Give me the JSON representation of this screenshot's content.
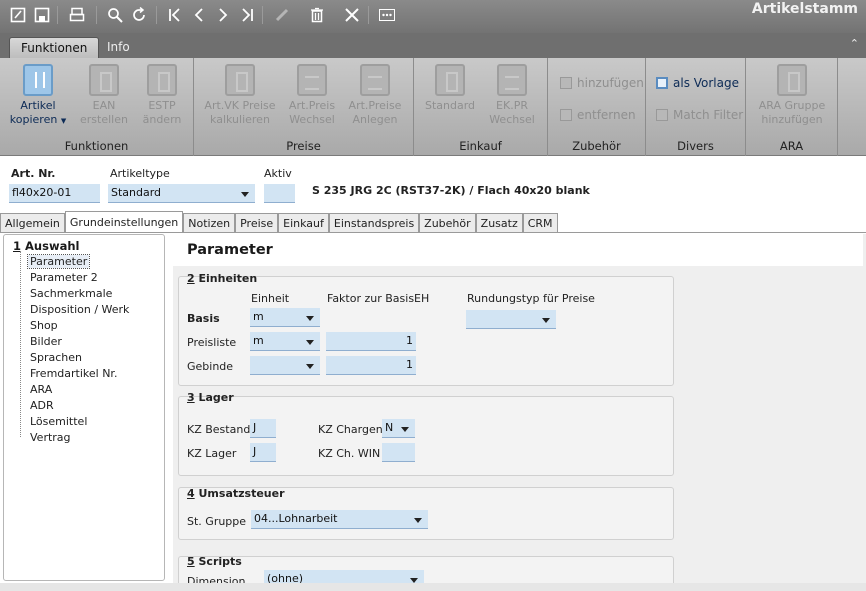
{
  "app_title": "Artikelstamm",
  "toolbar": {
    "icons": [
      "edit-icon",
      "save-icon",
      "print-icon",
      "search-icon",
      "refresh-icon",
      "first-record-icon",
      "prev-record-icon",
      "next-record-icon",
      "last-record-icon",
      "pencil-icon",
      "delete-icon",
      "close-icon",
      "more-icon"
    ]
  },
  "ribbon_tabs": [
    "Funktionen",
    "Info"
  ],
  "ribbon": {
    "groups": {
      "funktionen": "Funktionen",
      "preise": "Preise",
      "einkauf": "Einkauf",
      "zubehoer": "Zubehör",
      "divers": "Divers",
      "ara": "ARA"
    },
    "buttons": {
      "artikel_kopieren": [
        "Artikel",
        "kopieren"
      ],
      "ean_erstellen": [
        "EAN",
        "erstellen"
      ],
      "estp_aendern": [
        "ESTP",
        "ändern"
      ],
      "art_vk_preise": [
        "Art.VK Preise",
        "kalkulieren"
      ],
      "art_preis_wechsel": [
        "Art.Preis",
        "Wechsel"
      ],
      "art_preise_anlegen": [
        "Art.Preise",
        "Anlegen"
      ],
      "standard": "Standard",
      "ek_pr_wechsel": [
        "EK.PR",
        "Wechsel"
      ],
      "hinzufuegen": "hinzufügen",
      "entfernen": "entfernen",
      "als_vorlage": "als Vorlage",
      "match_filter": "Match Filter",
      "ara_gruppe": [
        "ARA Gruppe",
        "hinzufügen"
      ]
    }
  },
  "header": {
    "art_nr_label": "Art. Nr.",
    "art_nr_value": "fl40x20-01",
    "artikeltype_label": "Artikeltype",
    "artikeltype_value": "Standard",
    "aktiv_label": "Aktiv",
    "aktiv_value": "",
    "description": "S 235 JRG 2C (RST37-2K) / Flach 40x20 blank"
  },
  "tabs": [
    "Allgemein",
    "Grundeinstellungen",
    "Notizen",
    "Preise",
    "Einkauf",
    "Einstandspreis",
    "Zubehör",
    "Zusatz",
    "CRM"
  ],
  "tree": {
    "title_num": "1",
    "title": "Auswahl",
    "items": [
      "Parameter",
      "Parameter 2",
      "Sachmerkmale",
      "Disposition / Werk",
      "Shop",
      "Bilder",
      "Sprachen",
      "Fremdartikel Nr.",
      "ARA",
      "ADR",
      "Lösemittel",
      "Vertrag"
    ]
  },
  "main": {
    "title": "Parameter",
    "einheiten": {
      "num": "2",
      "title": "Einheiten",
      "col_einheit": "Einheit",
      "col_faktor": "Faktor zur BasisEH",
      "col_rundung": "Rundungstyp für Preise",
      "row_basis": "Basis",
      "row_preisliste": "Preisliste",
      "row_gebinde": "Gebinde",
      "basis_einheit": "m",
      "preisliste_einheit": "m",
      "preisliste_faktor": "1",
      "gebinde_einheit": "",
      "gebinde_faktor": "1",
      "rundungstyp": ""
    },
    "lager": {
      "num": "3",
      "title": "Lager",
      "kz_bestand_label": "KZ Bestand",
      "kz_bestand": "J",
      "kz_lager_label": "KZ Lager",
      "kz_lager": "J",
      "kz_chargen_label": "KZ Chargen",
      "kz_chargen": "N",
      "kz_ch_win_label": "KZ Ch. WIN",
      "kz_ch_win": ""
    },
    "umsatzsteuer": {
      "num": "4",
      "title": "Umsatzsteuer",
      "st_gruppe_label": "St. Gruppe",
      "st_gruppe": "04...Lohnarbeit"
    },
    "scripts": {
      "num": "5",
      "title": "Scripts",
      "dimension_label": "Dimension",
      "dimension": "(ohne)"
    }
  }
}
